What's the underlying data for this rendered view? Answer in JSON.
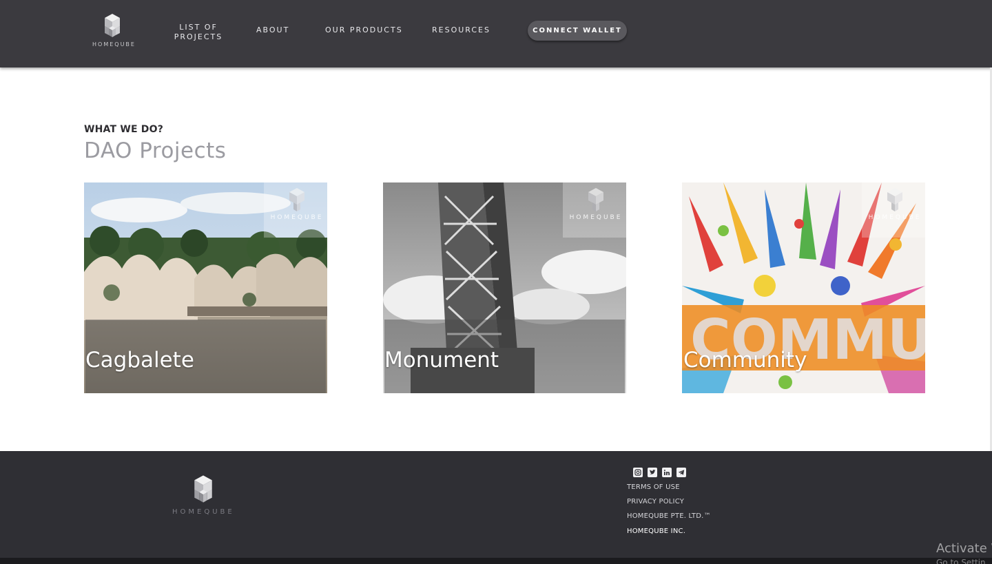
{
  "header": {
    "logo_text": "HOMEQUBE",
    "nav": {
      "list_of_projects_line1": "LIST OF",
      "list_of_projects_line2": "PROJECTS",
      "about": "ABOUT",
      "our_products": "OUR PRODUCTS",
      "resources": "RESOURCES"
    },
    "connect_wallet": "CONNECT WALLET"
  },
  "section": {
    "eyebrow": "WHAT WE DO?",
    "title": "DAO Projects"
  },
  "cards": [
    {
      "title": "Cagbalete",
      "watermark": "HOMEQUBE"
    },
    {
      "title": "Monument",
      "watermark": "HOMEQUBE"
    },
    {
      "title": "Community",
      "watermark": "HOMEQUBE",
      "band_text": "COMMUNI"
    }
  ],
  "footer": {
    "logo_text": "HOMEQUBE",
    "socials": [
      "instagram-icon",
      "twitter-icon",
      "linkedin-icon",
      "telegram-icon"
    ],
    "links": {
      "terms": "TERMS OF USE",
      "privacy": "PRIVACY POLICY",
      "company_pte": "HOMEQUBE PTE. LTD.™",
      "company_inc": "HOMEQUBE INC."
    }
  },
  "os_watermark": {
    "line1": "Activate W",
    "line2": "Go to Settin"
  },
  "colors": {
    "header_bg": "#3b3a3f",
    "footer_bg": "#2f2f34",
    "accent_orange": "#ee8c22"
  }
}
